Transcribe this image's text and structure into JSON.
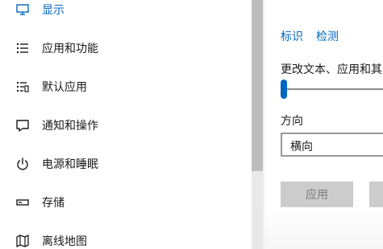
{
  "sidebar": {
    "items": [
      {
        "label": "显示",
        "icon": "monitor-icon",
        "active": true
      },
      {
        "label": "应用和功能",
        "icon": "list-icon",
        "active": false
      },
      {
        "label": "默认应用",
        "icon": "list-shortcut-icon",
        "active": false
      },
      {
        "label": "通知和操作",
        "icon": "message-icon",
        "active": false
      },
      {
        "label": "电源和睡眠",
        "icon": "power-icon",
        "active": false
      },
      {
        "label": "存储",
        "icon": "storage-icon",
        "active": false
      },
      {
        "label": "离线地图",
        "icon": "map-icon",
        "active": false
      }
    ]
  },
  "content": {
    "links": {
      "identify": "标识",
      "detect": "检测"
    },
    "scale_label": "更改文本、应用和其",
    "orientation": {
      "label": "方向",
      "value": "横向"
    },
    "apply_label": "应用"
  },
  "colors": {
    "accent": "#0067c0",
    "text": "#1a1a1a"
  }
}
